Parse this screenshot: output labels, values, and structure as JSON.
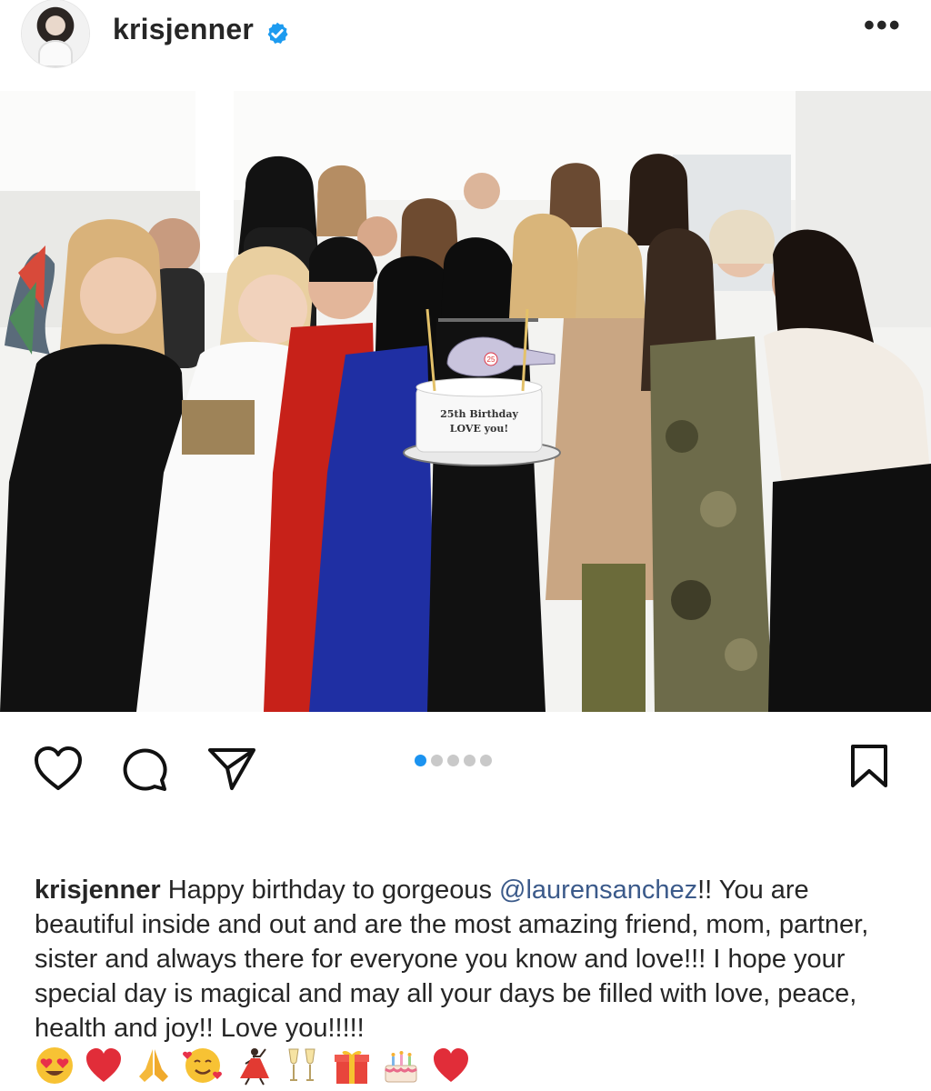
{
  "header": {
    "username": "krisjenner",
    "verified_icon": "verified-badge-icon",
    "more_icon": "more-options-icon",
    "more_label": "•••"
  },
  "post": {
    "image": {
      "cake_text_line1": "25th Birthday",
      "cake_text_line2": "LOVE you!",
      "topper_number": "25"
    },
    "carousel": {
      "count": 5,
      "active_index": 0
    },
    "actions": {
      "like_icon": "heart-icon",
      "comment_icon": "comment-icon",
      "share_icon": "send-icon",
      "save_icon": "bookmark-icon"
    }
  },
  "caption": {
    "user": "krisjenner",
    "text_before": " Happy birthday to gorgeous ",
    "mention": "@laurensanchez",
    "text_after": "!! You are beautiful inside and out and are the most amazing friend, mom, partner, sister and always there for everyone you know and love!!! I hope your special day is magical and may all your days be filled with love, peace, health and joy!! Love you!!!!!",
    "emojis": [
      "😍",
      "❤️",
      "🙏",
      "🥰",
      "💃",
      "🥂",
      "🎁",
      "🎂",
      "❤️"
    ]
  },
  "colors": {
    "accent_blue": "#1b93f0",
    "mention_blue": "#3b5a8a",
    "verified_blue": "#1d9bf0"
  }
}
